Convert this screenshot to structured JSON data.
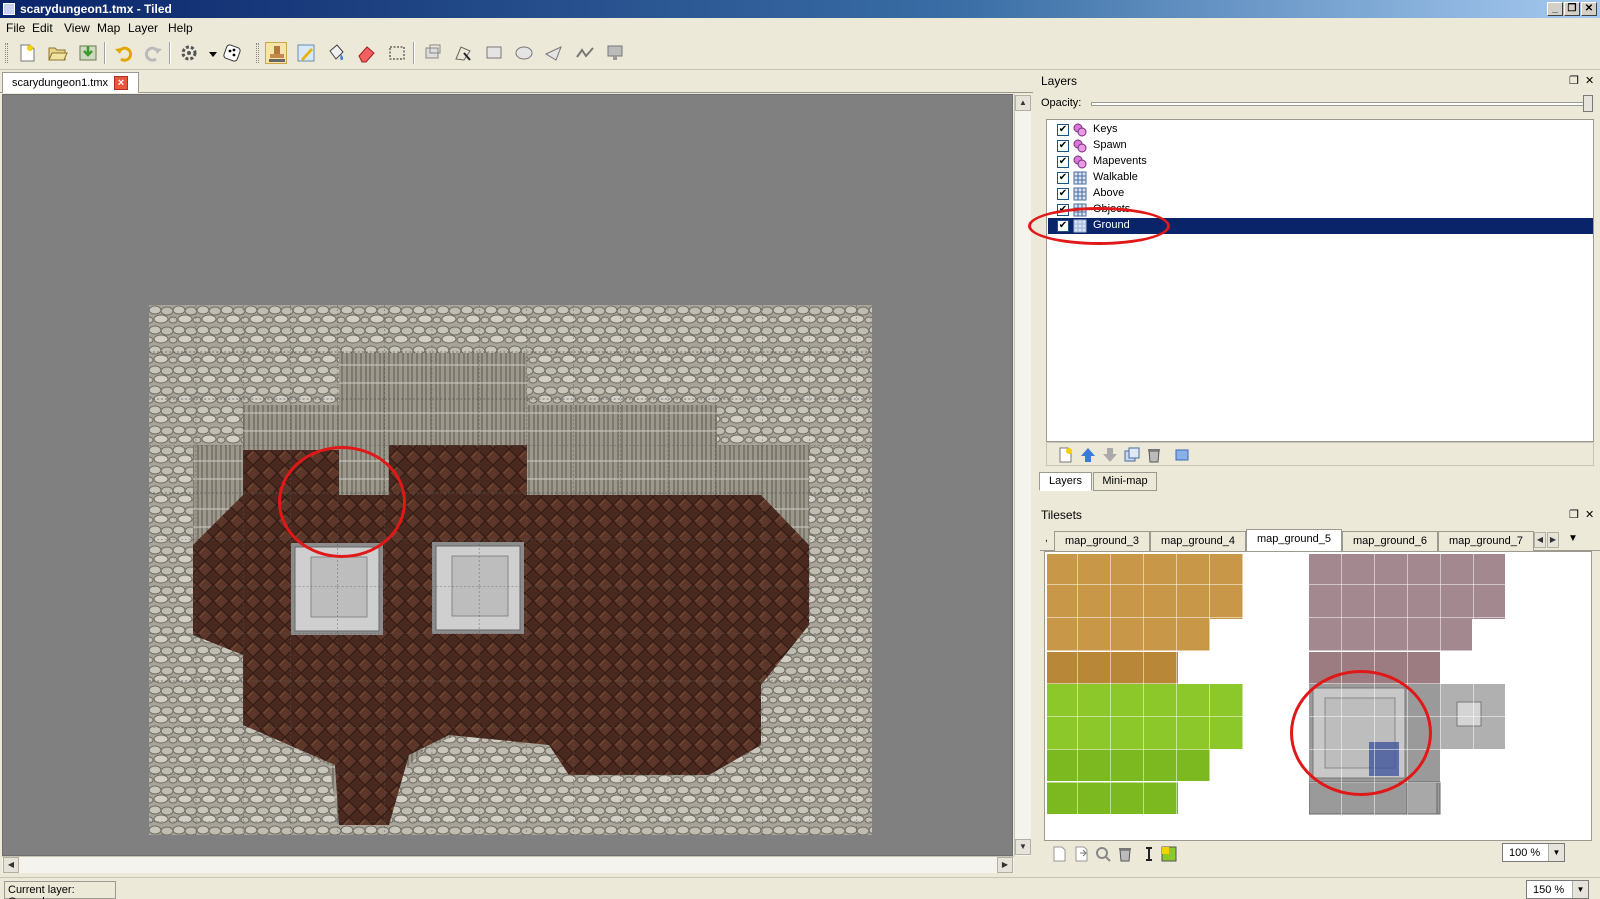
{
  "window": {
    "title": "scarydungeon1.tmx - Tiled"
  },
  "menu": [
    "File",
    "Edit",
    "View",
    "Map",
    "Layer",
    "Help"
  ],
  "toolbar": {
    "icons": [
      "new-icon",
      "open-icon",
      "save-icon",
      "undo-icon",
      "redo-icon",
      "commands-icon",
      "random-mode-icon",
      "stamp-brush-icon",
      "terrain-brush-icon",
      "bucket-fill-icon",
      "eraser-icon",
      "rectangle-select-icon",
      "select-objects-icon",
      "edit-polygons-icon",
      "insert-rectangle-icon",
      "insert-ellipse-icon",
      "insert-polygon-icon",
      "insert-polyline-icon",
      "insert-tile-icon"
    ]
  },
  "document": {
    "tab_label": "scarydungeon1.tmx"
  },
  "layers_panel": {
    "title": "Layers",
    "opacity_label": "Opacity:",
    "opacity": 1.0,
    "layers": [
      {
        "name": "Keys",
        "type": "object",
        "visible": true,
        "selected": false
      },
      {
        "name": "Spawn",
        "type": "object",
        "visible": true,
        "selected": false
      },
      {
        "name": "Mapevents",
        "type": "object",
        "visible": true,
        "selected": false
      },
      {
        "name": "Walkable",
        "type": "tile",
        "visible": true,
        "selected": false
      },
      {
        "name": "Above",
        "type": "tile",
        "visible": true,
        "selected": false
      },
      {
        "name": "Objects",
        "type": "tile",
        "visible": true,
        "selected": false
      },
      {
        "name": "Ground",
        "type": "tile",
        "visible": true,
        "selected": true
      }
    ],
    "tabs": [
      "Layers",
      "Mini-map"
    ],
    "active_tab": "Layers"
  },
  "tilesets_panel": {
    "title": "Tilesets",
    "tabs": [
      "map_ground_3",
      "map_ground_4",
      "map_ground_5",
      "map_ground_6",
      "map_ground_7"
    ],
    "active_tab": "map_ground_5",
    "zoom": "100 %"
  },
  "map_zoom": "150 %",
  "status": {
    "text": "Current layer: Ground"
  },
  "colors": {
    "selection": "#0a246a",
    "annotation": "#e01818",
    "wall": "#b8b4a8",
    "floor": "#4a2a20",
    "tile_stone": "#c4c4c4"
  }
}
